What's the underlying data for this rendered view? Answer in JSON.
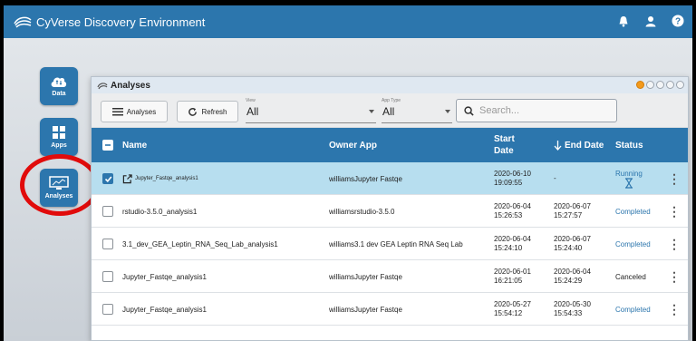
{
  "app": {
    "title": "CyVerse Discovery Environment"
  },
  "topbar_icons": [
    "bell-icon",
    "user-icon",
    "help-icon"
  ],
  "launchers": [
    {
      "label": "Data",
      "icon": "cloud-icon"
    },
    {
      "label": "Apps",
      "icon": "grid-icon"
    },
    {
      "label": "Analyses",
      "icon": "monitor-chart-icon"
    }
  ],
  "window": {
    "title": "Analyses",
    "toolbar": {
      "analyses_label": "Analyses",
      "refresh_label": "Refresh",
      "view_caption": "View",
      "view_value": "All",
      "apptype_caption": "App Type",
      "apptype_value": "All",
      "search_placeholder": "Search..."
    },
    "columns": {
      "name": "Name",
      "owner_app": "Owner App",
      "start_date_line1": "Start",
      "start_date_line2": "Date",
      "end_date": "End Date",
      "status": "Status"
    },
    "rows": [
      {
        "name": "Jupyter_Fastqe_analysis1",
        "owner_app": "williamsJupyter Fastqe",
        "start_date": "2020-06-10",
        "start_time": "19:09:55",
        "end_date": "-",
        "end_time": "",
        "status": "Running",
        "selected": true
      },
      {
        "name": "rstudio-3.5.0_analysis1",
        "owner_app": "williamsrstudio-3.5.0",
        "start_date": "2020-06-04",
        "start_time": "15:26:53",
        "end_date": "2020-06-07",
        "end_time": "15:27:57",
        "status": "Completed",
        "selected": false
      },
      {
        "name": "3.1_dev_GEA_Leptin_RNA_Seq_Lab_analysis1",
        "owner_app": "williams3.1 dev GEA Leptin RNA Seq Lab",
        "start_date": "2020-06-04",
        "start_time": "15:24:10",
        "end_date": "2020-06-07",
        "end_time": "15:24:40",
        "status": "Completed",
        "selected": false
      },
      {
        "name": "Jupyter_Fastqe_analysis1",
        "owner_app": "williamsJupyter Fastqe",
        "start_date": "2020-06-01",
        "start_time": "16:21:05",
        "end_date": "2020-06-04",
        "end_time": "15:24:29",
        "status": "Canceled",
        "selected": false
      },
      {
        "name": "Jupyter_Fastqe_analysis1",
        "owner_app": "williamsJupyter Fastqe",
        "start_date": "2020-05-27",
        "start_time": "15:54:12",
        "end_date": "2020-05-30",
        "end_time": "15:54:33",
        "status": "Completed",
        "selected": false
      }
    ]
  },
  "colors": {
    "brand": "#2c76ad",
    "selected_row": "#b7deef",
    "highlight_circle": "#e10b0b"
  }
}
